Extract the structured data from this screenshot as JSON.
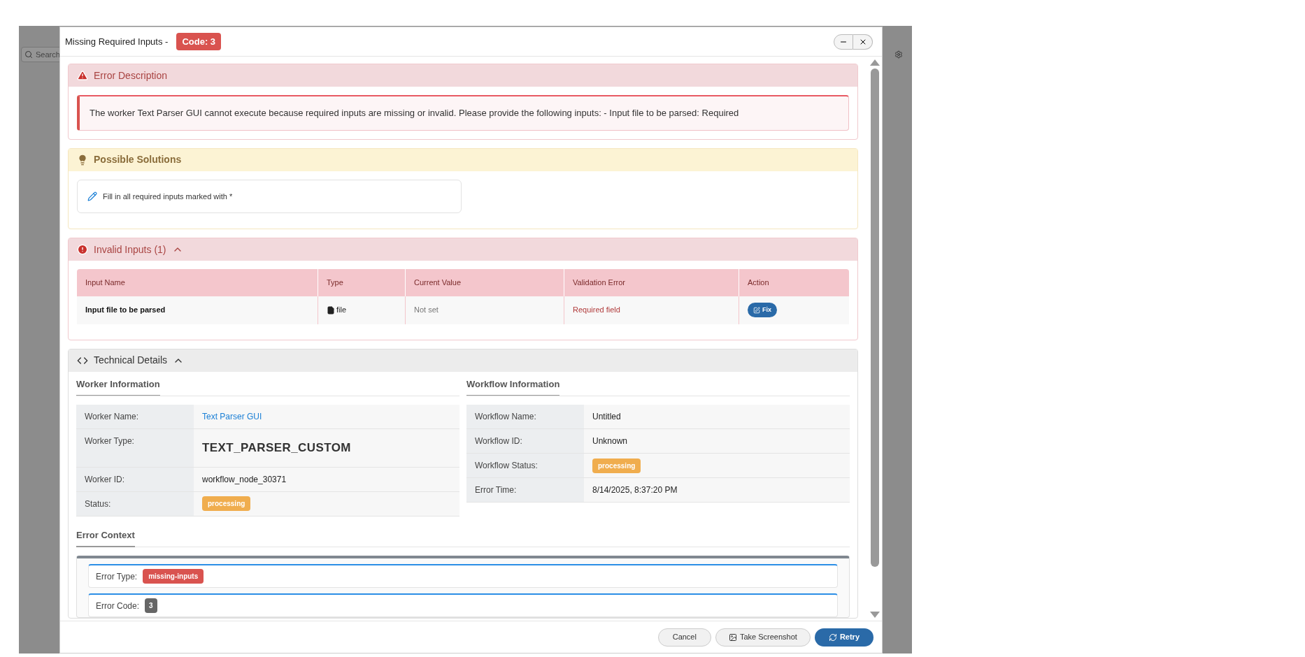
{
  "background": {
    "search_placeholder": "Search"
  },
  "dialog": {
    "title": "Missing Required Inputs -",
    "code_badge": "Code: 3"
  },
  "error_description": {
    "title": "Error Description",
    "message": "The worker Text Parser GUI cannot execute because required inputs are missing or invalid. Please provide the following inputs: - Input file to be parsed: Required"
  },
  "possible_solutions": {
    "title": "Possible Solutions",
    "items": [
      "Fill in all required inputs marked with *"
    ]
  },
  "invalid_inputs": {
    "title": "Invalid Inputs (1)",
    "expanded": true,
    "columns": [
      "Input Name",
      "Type",
      "Current Value",
      "Validation Error",
      "Action"
    ],
    "rows": [
      {
        "name": "Input file to be parsed",
        "type": "file",
        "current_value": "Not set",
        "validation_error": "Required field",
        "action": "Fix"
      }
    ]
  },
  "technical_details": {
    "title": "Technical Details",
    "expanded": true,
    "worker_information": {
      "title": "Worker Information",
      "rows": [
        {
          "label": "Worker Name:",
          "value": "Text Parser GUI",
          "kind": "link"
        },
        {
          "label": "Worker Type:",
          "value": "TEXT_PARSER_CUSTOM",
          "kind": "large"
        },
        {
          "label": "Worker ID:",
          "value": "workflow_node_30371",
          "kind": "text"
        },
        {
          "label": "Status:",
          "value": "processing",
          "kind": "badge"
        }
      ]
    },
    "workflow_information": {
      "title": "Workflow Information",
      "rows": [
        {
          "label": "Workflow Name:",
          "value": "Untitled",
          "kind": "text"
        },
        {
          "label": "Workflow ID:",
          "value": "Unknown",
          "kind": "text"
        },
        {
          "label": "Workflow Status:",
          "value": "processing",
          "kind": "badge"
        },
        {
          "label": "Error Time:",
          "value": "8/14/2025, 8:37:20 PM",
          "kind": "text"
        }
      ]
    },
    "error_context": {
      "title": "Error Context",
      "rows": [
        {
          "label": "Error Type:",
          "value": "missing-inputs",
          "kind": "danger"
        },
        {
          "label": "Error Code:",
          "value": "3",
          "kind": "dark"
        }
      ]
    }
  },
  "footer": {
    "buttons": [
      {
        "label": "Cancel",
        "kind": "default"
      },
      {
        "label": "Take Screenshot",
        "kind": "screenshot"
      },
      {
        "label": "Retry",
        "kind": "primary"
      }
    ]
  }
}
